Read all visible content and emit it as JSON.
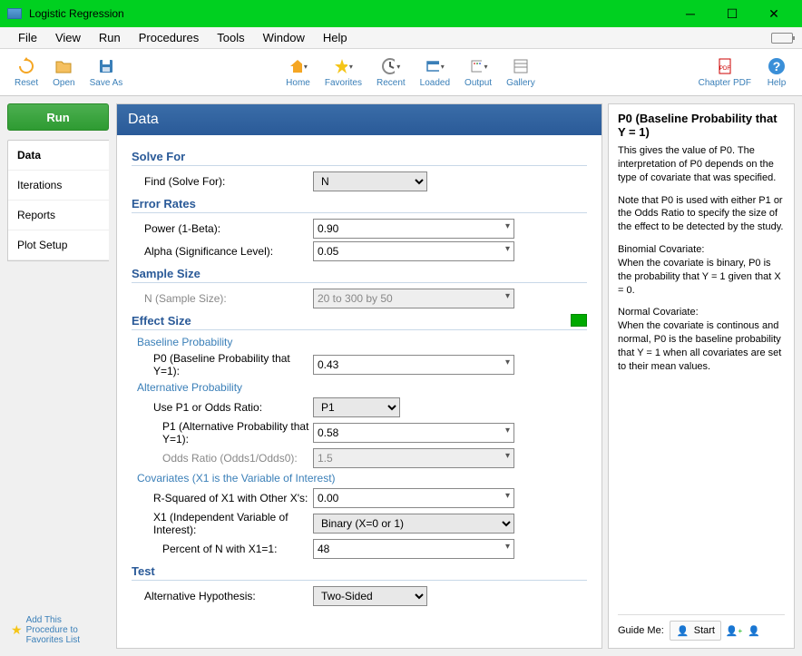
{
  "window": {
    "title": "Logistic Regression"
  },
  "menubar": [
    "File",
    "View",
    "Run",
    "Procedures",
    "Tools",
    "Window",
    "Help"
  ],
  "toolbar": {
    "reset": "Reset",
    "open": "Open",
    "saveas": "Save As",
    "home": "Home",
    "favorites": "Favorites",
    "recent": "Recent",
    "loaded": "Loaded",
    "output": "Output",
    "gallery": "Gallery",
    "chapterpdf": "Chapter PDF",
    "help": "Help"
  },
  "run": "Run",
  "tabs": {
    "data": "Data",
    "iterations": "Iterations",
    "reports": "Reports",
    "plotsetup": "Plot Setup"
  },
  "fav": "Add This\nProcedure to\nFavorites List",
  "form": {
    "title": "Data",
    "sections": {
      "solvefor": "Solve For",
      "errorrates": "Error Rates",
      "samplesize": "Sample Size",
      "effectsize": "Effect Size",
      "test": "Test"
    },
    "subsections": {
      "baseline": "Baseline Probability",
      "alternative": "Alternative Probability",
      "covariates": "Covariates (X1 is the Variable of Interest)"
    },
    "labels": {
      "find": "Find (Solve For):",
      "power": "Power (1-Beta):",
      "alpha": "Alpha (Significance Level):",
      "n": "N (Sample Size):",
      "p0": "P0 (Baseline Probability that Y=1):",
      "usep1": "Use P1 or Odds Ratio:",
      "p1": "P1 (Alternative Probability that Y=1):",
      "oddsratio": "Odds Ratio (Odds1/Odds0):",
      "rsq": "R-Squared of X1 with Other X's:",
      "x1": "X1 (Independent Variable of Interest):",
      "pctn": "Percent of N with X1=1:",
      "althyp": "Alternative Hypothesis:"
    },
    "values": {
      "find": "N",
      "power": "0.90",
      "alpha": "0.05",
      "n": "20 to 300 by 50",
      "p0": "0.43",
      "usep1": "P1",
      "p1": "0.58",
      "oddsratio": "1.5",
      "rsq": "0.00",
      "x1": "Binary (X=0 or 1)",
      "pctn": "48",
      "althyp": "Two-Sided"
    }
  },
  "help": {
    "title": "P0 (Baseline Probability that Y = 1)",
    "p1": "This gives the value of P0. The interpretation of P0 depends on the type of covariate that was specified.",
    "p2": "Note that P0 is used with either P1 or the Odds Ratio to specify the size of the effect to be detected by the study.",
    "p3h": "Binomial Covariate:",
    "p3": "When the covariate is binary, P0 is the probability that Y = 1 given that X = 0.",
    "p4h": "Normal Covariate:",
    "p4": "When the covariate is continous and normal, P0 is the baseline probability that Y = 1 when all covariates are set to their mean values."
  },
  "guide": {
    "label": "Guide Me:",
    "start": "Start"
  }
}
